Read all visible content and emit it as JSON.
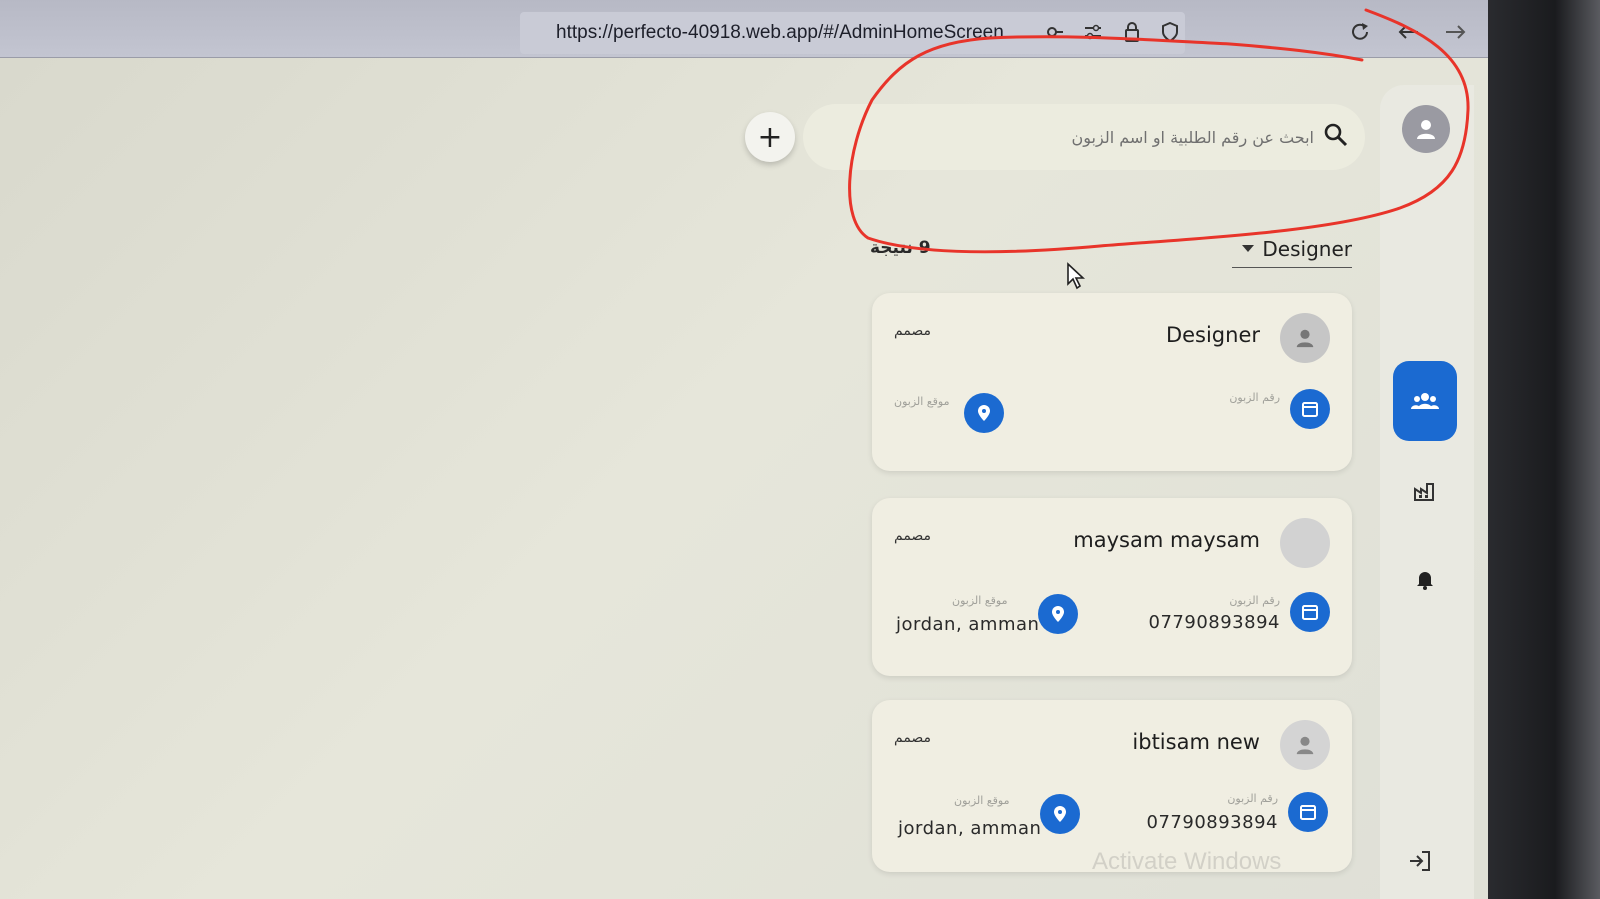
{
  "browser": {
    "url": "https://perfecto-40918.web.app/#/AdminHomeScreen"
  },
  "search": {
    "placeholder": "ابحث عن رقم الطلبية او اسم الزبون",
    "add_label": "+"
  },
  "filter": {
    "selected": "Designer",
    "result_count": "9 نتيجة"
  },
  "cards": [
    {
      "name": "Designer",
      "role": "مصمم",
      "phone_label": "رقم الزبون",
      "phone": "",
      "location_label": "موقع الزبون",
      "location": ""
    },
    {
      "name": "maysam maysam",
      "role": "مصمم",
      "phone_label": "رقم الزبون",
      "phone": "07790893894",
      "location_label": "موقع الزبون",
      "location": "jordan, amman"
    },
    {
      "name": "ibtisam new",
      "role": "مصمم",
      "phone_label": "رقم الزبون",
      "phone": "07790893894",
      "location_label": "موقع الزبون",
      "location": "jordan, amman"
    }
  ],
  "watermark": "Activate Windows",
  "colors": {
    "accent": "#1b6ad1",
    "annotation": "#e8342a",
    "card_bg": "#f0eee2"
  }
}
